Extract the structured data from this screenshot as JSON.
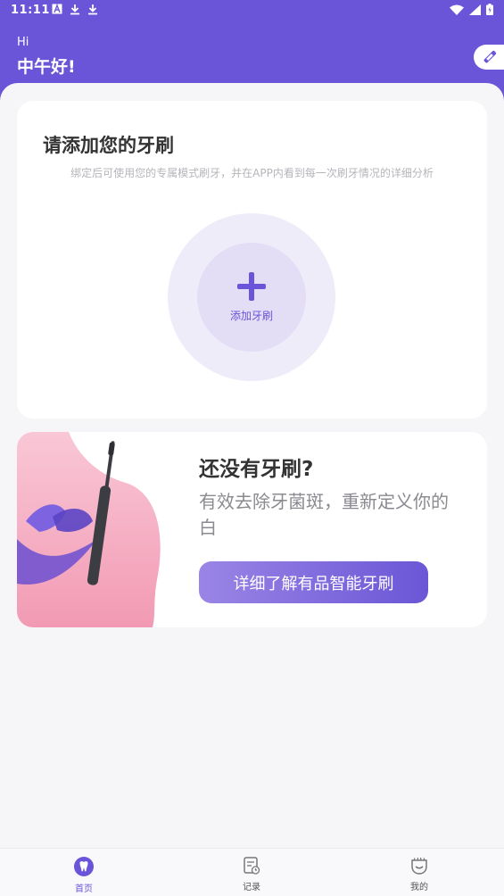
{
  "status_bar": {
    "time": "11:11",
    "left_icons": [
      "a-icon",
      "download-icon",
      "download-icon"
    ],
    "right_icons": [
      "wifi-icon",
      "signal-icon",
      "battery-icon"
    ]
  },
  "header": {
    "hi": "Hi",
    "greeting": "中午好!",
    "pill_icon": "edit-icon",
    "color": "#6a55d8"
  },
  "add_card": {
    "title": "请添加您的牙刷",
    "subtitle": "绑定后可使用您的专属模式刷牙，并在APP内看到每一次刷牙情况的详细分析",
    "add_label": "添加牙刷"
  },
  "promo_card": {
    "title": "还没有牙刷?",
    "description": "有效去除牙菌斑，重新定义你的白",
    "button_label": "详细了解有品智能牙刷"
  },
  "tab_bar": {
    "tabs": [
      {
        "label": "首页",
        "icon": "tooth-icon",
        "active": true
      },
      {
        "label": "记录",
        "icon": "record-icon",
        "active": false
      },
      {
        "label": "我的",
        "icon": "profile-icon",
        "active": false
      }
    ]
  }
}
